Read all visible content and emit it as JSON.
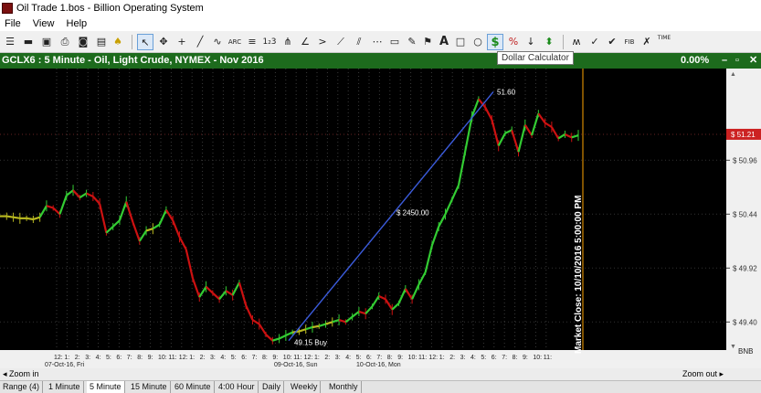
{
  "window": {
    "title": "Oil Trade 1.bos - Billion Operating System"
  },
  "menu": [
    "File",
    "View",
    "Help"
  ],
  "toolbar": {
    "icons": [
      "open-icon",
      "folder-icon",
      "save-icon",
      "print-icon",
      "camera-icon",
      "print-preview-icon",
      "alert-bell-icon",
      "cursor-icon",
      "crosshair-icon",
      "plus-icon",
      "line-icon",
      "freehand-icon",
      "arc-icon",
      "fibonacci-icon",
      "wave-count-icon",
      "pitchfork-icon",
      "angle-icon",
      "trend-fan-icon",
      "gann-fan-icon",
      "channel-icon",
      "regression-channel-icon",
      "flag-icon",
      "text-icon",
      "rectangle-icon",
      "ellipse-icon",
      "dollar-calculator-icon",
      "percent-icon",
      "arrow-icon",
      "buy-sell-icon",
      "elliott-wave-icon",
      "cycle-icon",
      "fib-time-icon",
      "speed-lines-icon",
      "time-cycles-icon"
    ],
    "labels": {
      "arc": "ARC",
      "fib": "FIB",
      "time": "TIME",
      "text": "A",
      "dollar": "$",
      "percent": "%"
    },
    "tooltip": "Dollar Calculator"
  },
  "chart_header": {
    "symbol": "GCLX6 : 5 Minute  -  Oil, Light Crude, NYMEX - Nov 2016",
    "change": "0.00%"
  },
  "chart_data": {
    "type": "line",
    "title": "GCLX6 : 5 Minute  -  Oil, Light Crude, NYMEX - Nov 2016",
    "ylim": [
      49.2,
      51.8
    ],
    "yticks": [
      {
        "value": 51.21,
        "label": "$ 51.21",
        "current": true
      },
      {
        "value": 50.96,
        "label": "$ 50.96"
      },
      {
        "value": 50.44,
        "label": "$ 50.44"
      },
      {
        "value": 49.92,
        "label": "$ 49.92"
      },
      {
        "value": 49.4,
        "label": "$ 49.40"
      }
    ],
    "xtick_labels": [
      "12:00",
      "1:00",
      "2:00",
      "3:00",
      "4:00",
      "5:00",
      "6:00",
      "7:00",
      "8:00",
      "9:00",
      "10:00",
      "11:00",
      "12:00",
      "1:00",
      "2:00",
      "3:00",
      "4:00",
      "5:00",
      "6:00",
      "7:00",
      "8:00",
      "9:00",
      "10:00",
      "11:00",
      "12:00",
      "1:00",
      "2:00",
      "3:00",
      "4:00",
      "5:00",
      "6:00",
      "7:00",
      "8:00",
      "9:00",
      "10:00",
      "11:00",
      "12:00",
      "1:00",
      "2:00",
      "3:00",
      "4:00",
      "5:00",
      "6:00",
      "7:00",
      "8:00",
      "9:00",
      "10:00",
      "11:00"
    ],
    "date_labels": [
      "07-Oct-16, Fri",
      "09-Oct-16, Sun",
      "10-Oct-16, Mon"
    ],
    "series": [
      {
        "values": [
          50.42,
          50.42,
          50.41,
          50.4,
          50.4,
          50.39,
          50.41,
          50.52,
          50.5,
          50.44,
          50.62,
          50.67,
          50.6,
          50.64,
          50.61,
          50.54,
          50.26,
          50.32,
          50.38,
          50.56,
          50.36,
          50.18,
          50.28,
          50.3,
          50.34,
          50.48,
          50.38,
          50.22,
          50.1,
          49.82,
          49.64,
          49.74,
          49.68,
          49.62,
          49.7,
          49.66,
          49.78,
          49.56,
          49.42,
          49.38,
          49.28,
          49.22,
          49.24,
          49.27,
          49.3,
          49.31,
          49.33,
          49.35,
          49.36,
          49.38,
          49.4,
          49.42,
          49.4,
          49.45,
          49.5,
          49.48,
          49.55,
          49.65,
          49.62,
          49.52,
          49.58,
          49.72,
          49.62,
          49.76,
          49.88,
          50.14,
          50.32,
          50.44,
          50.58,
          50.72,
          51.05,
          51.38,
          51.55,
          51.47,
          51.35,
          51.1,
          51.22,
          51.25,
          51.04,
          51.3,
          51.2,
          51.41,
          51.32,
          51.28,
          51.17,
          51.21,
          51.18,
          51.2
        ]
      }
    ],
    "annotations": {
      "buy_label": "49.15 Buy",
      "peak_label": "51.60",
      "profit_label": "$ 2450.00",
      "market_close": "Market Close: 10/10/2016 5:00:00 PM",
      "bnb": "BNB"
    },
    "colors": {
      "background": "#000000",
      "up": "#33cc33",
      "down": "#cc1111",
      "neutral": "#b8b820",
      "measure_line": "#3b5bdb",
      "market_close": "#ffa500",
      "current_price": "#cc2222"
    }
  },
  "bottom_bar": {
    "zoom_in": "Zoom in",
    "zoom_out": "Zoom out"
  },
  "tabs": [
    "Range (4)",
    "1 Minute",
    "5 Minute",
    "15 Minute",
    "60 Minute",
    "4:00 Hour",
    "Daily",
    "Weekly",
    "Monthly"
  ],
  "active_tab": "5 Minute"
}
